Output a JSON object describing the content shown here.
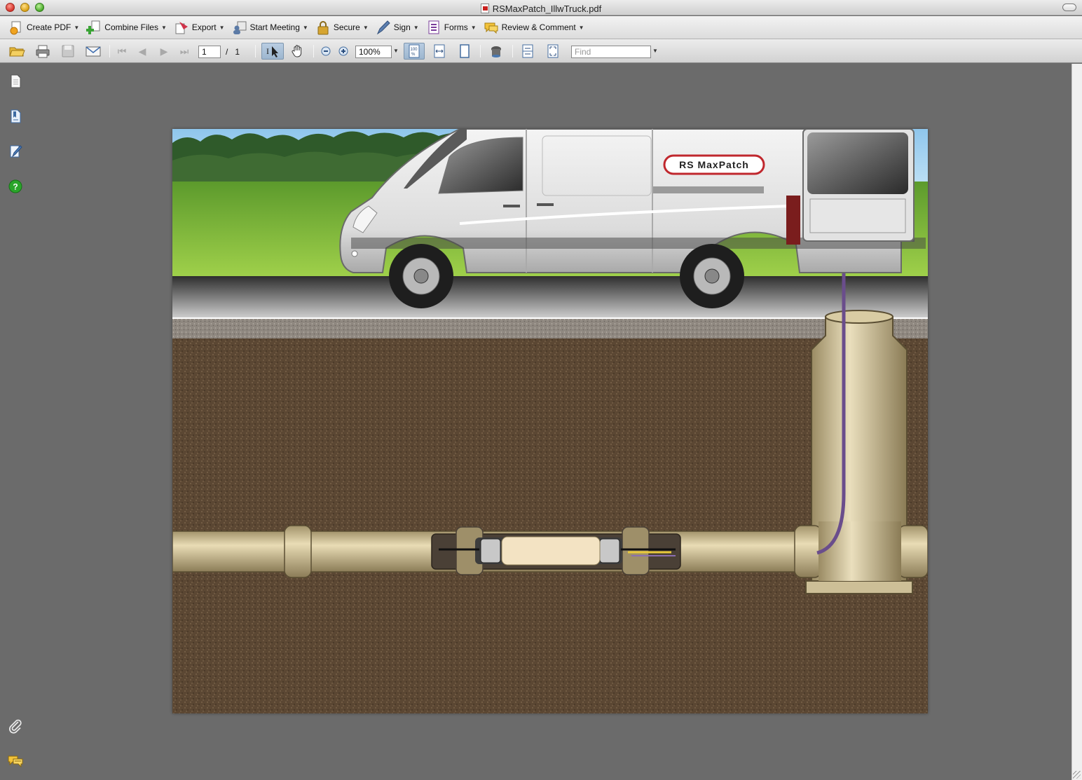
{
  "window": {
    "title": "RSMaxPatch_IllwTruck.pdf"
  },
  "tasks": [
    {
      "label": "Create PDF",
      "icon": "create-pdf-icon"
    },
    {
      "label": "Combine Files",
      "icon": "combine-files-icon"
    },
    {
      "label": "Export",
      "icon": "export-icon"
    },
    {
      "label": "Start Meeting",
      "icon": "start-meeting-icon"
    },
    {
      "label": "Secure",
      "icon": "lock-icon"
    },
    {
      "label": "Sign",
      "icon": "pen-icon"
    },
    {
      "label": "Forms",
      "icon": "forms-icon"
    },
    {
      "label": "Review & Comment",
      "icon": "comment-icon"
    }
  ],
  "navigation": {
    "current_page": "1",
    "separator": "/",
    "total_pages": "1",
    "zoom": "100%",
    "find_placeholder": "Find"
  },
  "document": {
    "logo_text": "RS MaxPatch"
  },
  "colors": {
    "accent_select": "#9db6cf",
    "help_green": "#2aa52a",
    "sky": "#a9d4f0",
    "grass": "#8dc63f",
    "soil": "#5a4632",
    "pipe": "#d8c79a",
    "logo_red": "#c0272d"
  }
}
